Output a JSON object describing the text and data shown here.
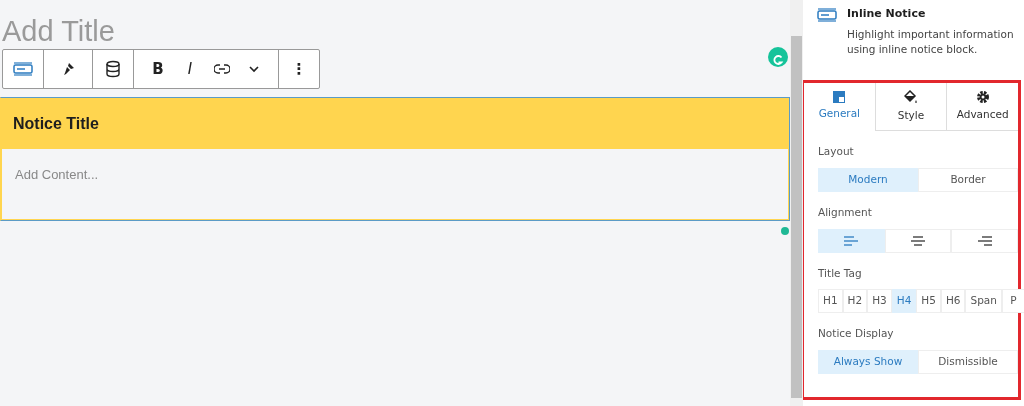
{
  "editor": {
    "title_placeholder": "Add Title",
    "toolbar": {
      "bold": "B",
      "italic": "I",
      "options": "⋮"
    },
    "notice": {
      "title": "Notice Title",
      "content_placeholder": "Add Content..."
    }
  },
  "sidebar": {
    "block": {
      "name": "Inline Notice",
      "description": "Highlight important information using inline notice block."
    },
    "tabs": [
      {
        "label": "General",
        "selected": true
      },
      {
        "label": "Style",
        "selected": false
      },
      {
        "label": "Advanced",
        "selected": false
      }
    ],
    "sections": [
      {
        "kind": "segmented",
        "label": "Layout",
        "options": [
          {
            "label": "Modern",
            "selected": true
          },
          {
            "label": "Border",
            "selected": false
          }
        ]
      },
      {
        "kind": "alignment",
        "label": "Alignment",
        "options": [
          {
            "selected": true
          },
          {
            "selected": false
          },
          {
            "selected": false
          }
        ]
      },
      {
        "kind": "segmented",
        "label": "Title Tag",
        "options": [
          {
            "label": "H1",
            "selected": false
          },
          {
            "label": "H2",
            "selected": false
          },
          {
            "label": "H3",
            "selected": false
          },
          {
            "label": "H4",
            "selected": true
          },
          {
            "label": "H5",
            "selected": false
          },
          {
            "label": "H6",
            "selected": false
          },
          {
            "label": "Span",
            "selected": false
          },
          {
            "label": "P",
            "selected": false
          }
        ]
      },
      {
        "kind": "segmented",
        "label": "Notice Display",
        "options": [
          {
            "label": "Always Show",
            "selected": true
          },
          {
            "label": "Dismissible",
            "selected": false
          }
        ]
      }
    ]
  }
}
